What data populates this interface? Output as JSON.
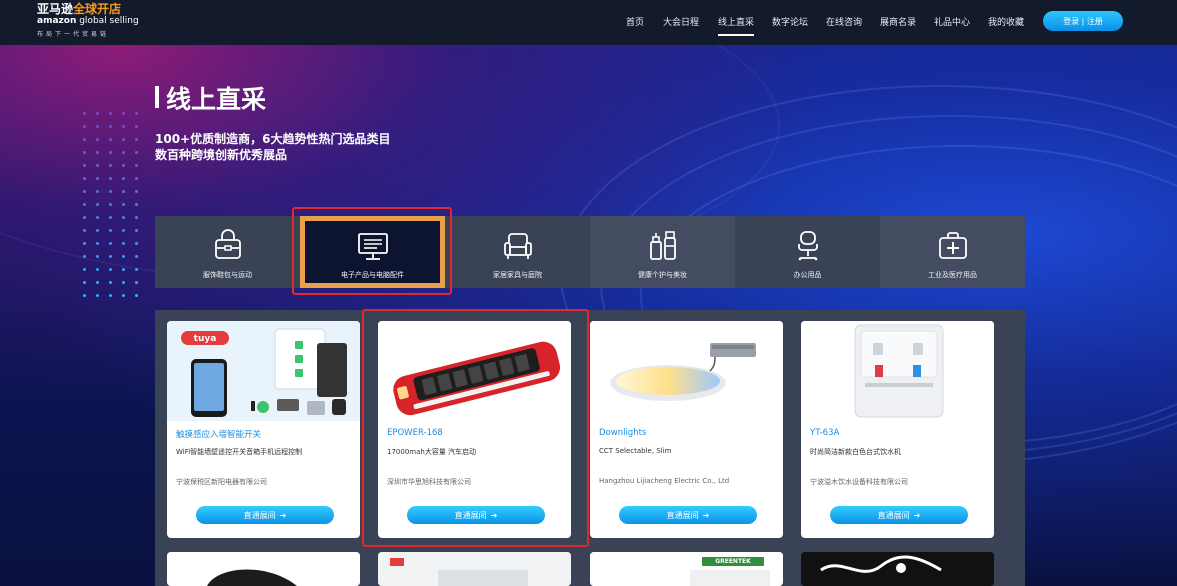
{
  "header": {
    "logo": {
      "line1_a": "亚马逊",
      "line1_b": "全球开店",
      "line2_a": "amazon",
      "line2_b": " global selling",
      "tagline": "布局下一代贸易链"
    },
    "nav": [
      "首页",
      "大会日程",
      "线上直采",
      "数字论坛",
      "在线咨询",
      "展商名录",
      "礼品中心",
      "我的收藏"
    ],
    "active_nav": "线上直采",
    "login_label": "登录 | 注册"
  },
  "hero": {
    "title": "线上直采",
    "subtitle_line1": "100+优质制造商，6大趋势性热门选品类目",
    "subtitle_line2": "数百种跨境创新优秀展品"
  },
  "categories": [
    {
      "label": "服饰鞋包与运动",
      "icon": "bag-icon",
      "active": false
    },
    {
      "label": "电子产品与电脑配件",
      "icon": "monitor-icon",
      "active": true
    },
    {
      "label": "家居家具与庭院",
      "icon": "armchair-icon",
      "active": false
    },
    {
      "label": "健康个护与美妆",
      "icon": "cosmetics-icon",
      "active": false
    },
    {
      "label": "办公用品",
      "icon": "office-chair-icon",
      "active": false
    },
    {
      "label": "工业及医疗用品",
      "icon": "medical-kit-icon",
      "active": false
    }
  ],
  "products": [
    {
      "name": "触摸感应入墙智能开关",
      "desc": "WiFi智能墙壁遥控开关音箱手机远程控制",
      "company": "宁波保税区新阳电器有限公司",
      "button": "直通展间",
      "image": "smart-switch-image"
    },
    {
      "name": "EPOWER-168",
      "desc": "17000mah大容量 汽车启动",
      "company": "深圳市华思旭科技有限公司",
      "button": "直通展间",
      "image": "jump-starter-image"
    },
    {
      "name": "Downlights",
      "desc": "CCT Selectable, Slim",
      "company": "Hangzhou Lijiacheng Electric Co., Ltd",
      "button": "直通展间",
      "image": "downlight-image"
    },
    {
      "name": "YT-63A",
      "desc": "时尚简洁新款白色台式饮水机",
      "company": "宁波溢木饮水设备科技有限公司",
      "button": "直通展间",
      "image": "water-dispenser-image"
    }
  ],
  "second_row_logo_texts": [
    "GREENTEK"
  ],
  "colors": {
    "accent_orange": "#f79a1e",
    "button_blue": "#14a3f0",
    "highlight_red": "#e0282e",
    "active_border": "#e8a04a",
    "link_blue": "#1b8de0"
  }
}
